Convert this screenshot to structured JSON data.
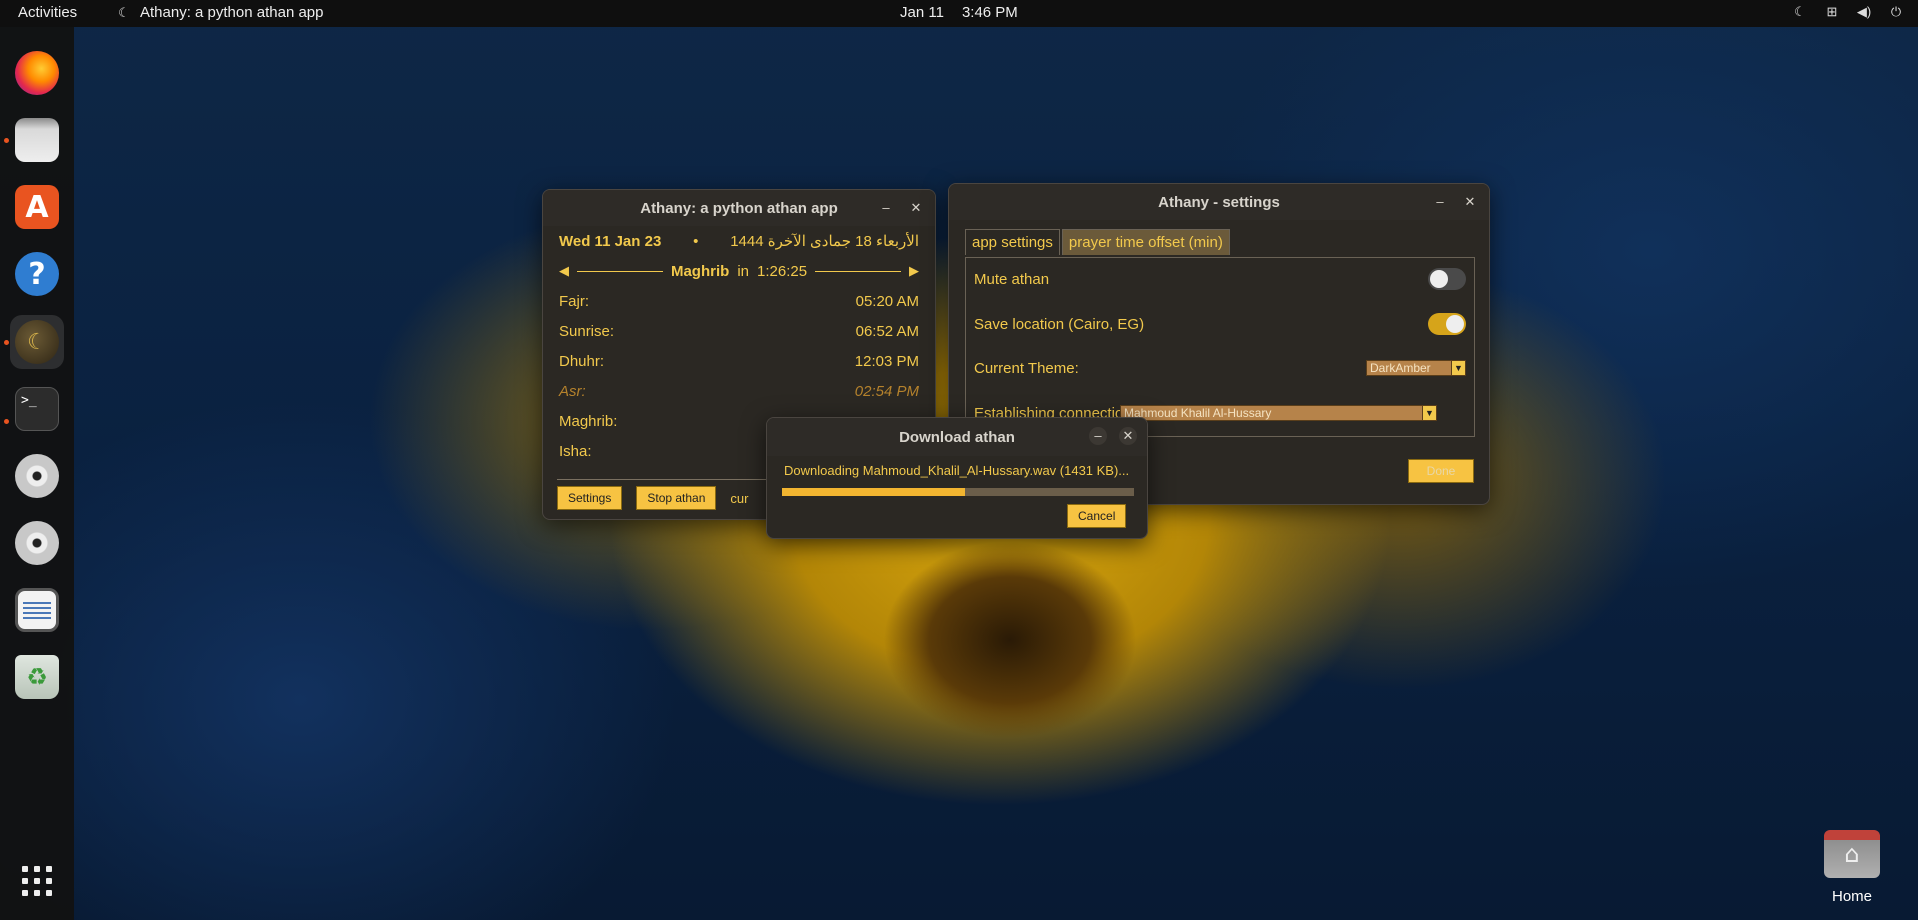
{
  "topbar": {
    "activities": "Activities",
    "app_title": "Athany: a python athan app",
    "date": "Jan 11",
    "time": "3:46 PM"
  },
  "dock": {
    "items": [
      "Firefox",
      "Files",
      "App Center",
      "Help",
      "Athany",
      "Terminal",
      "Disc 1",
      "Disc 2",
      "Text Editor",
      "Trash"
    ]
  },
  "desktop": {
    "home_label": "Home"
  },
  "main_window": {
    "title": "Athany: a python athan app",
    "gregorian_date": "Wed 11 Jan 23",
    "separator": "•",
    "hijri_date": "الأربعاء 18 جمادى الآخرة 1444",
    "next_prayer": "Maghrib",
    "in_label": "in",
    "countdown": "1:26:25",
    "prayers": [
      {
        "name": "Fajr:",
        "time": "05:20 AM"
      },
      {
        "name": "Sunrise:",
        "time": "06:52 AM"
      },
      {
        "name": "Dhuhr:",
        "time": "12:03 PM"
      },
      {
        "name": "Asr:",
        "time": "02:54 PM"
      },
      {
        "name": "Maghrib:",
        "time": ""
      },
      {
        "name": "Isha:",
        "time": ""
      }
    ],
    "settings_button": "Settings",
    "stop_athan_button": "Stop athan",
    "status_text": "cur"
  },
  "settings_window": {
    "title": "Athany - settings",
    "tabs": [
      "app settings",
      "prayer time offset (min)"
    ],
    "mute_label": "Mute athan",
    "save_location_label": "Save location (Cairo, EG)",
    "theme_label": "Current Theme:",
    "theme_value": "DarkAmber",
    "connection_label": "Establishing connection...",
    "athan_value": "Mahmoud Khalil Al-Hussary",
    "done_button": "Done"
  },
  "download_dialog": {
    "title": "Download athan",
    "message": "Downloading Mahmoud_Khalil_Al-Hussary.wav (1431 KB)...",
    "progress": 0.52,
    "cancel_button": "Cancel"
  }
}
